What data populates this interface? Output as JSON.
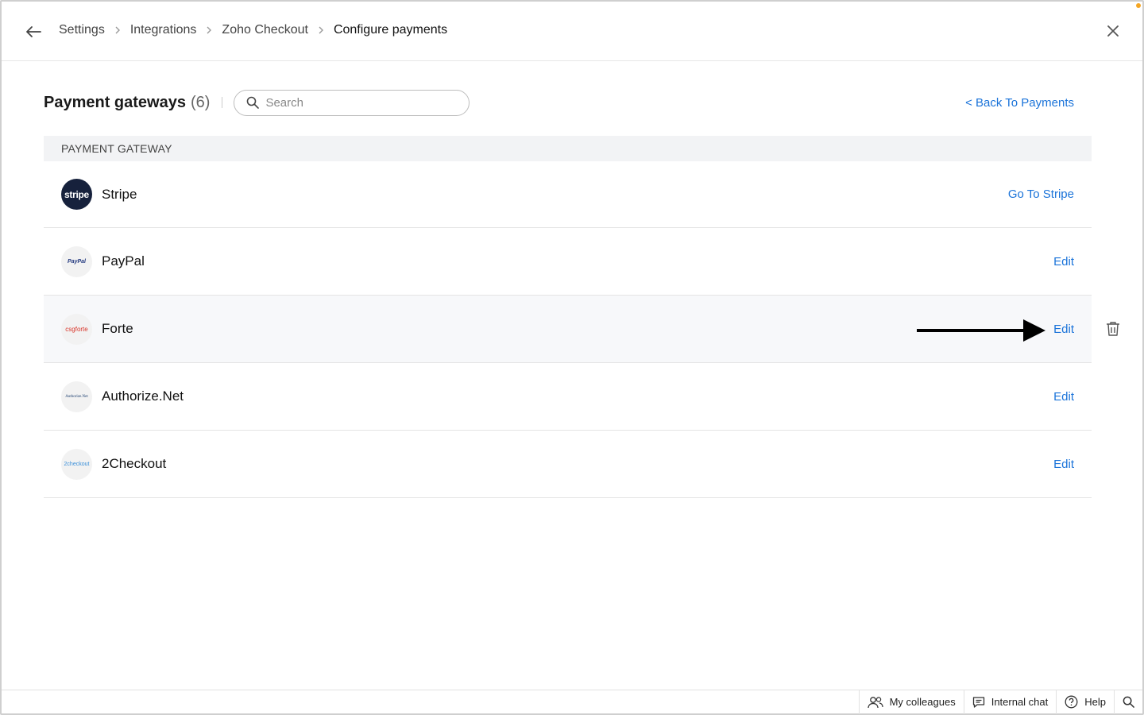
{
  "breadcrumb": {
    "items": [
      "Settings",
      "Integrations",
      "Zoho Checkout",
      "Configure payments"
    ]
  },
  "header": {
    "title": "Payment gateways",
    "count": "(6)",
    "search_placeholder": "Search",
    "back_link": "< Back To Payments"
  },
  "table": {
    "column_header": "PAYMENT GATEWAY",
    "rows": [
      {
        "name": "Stripe",
        "logo_text": "stripe",
        "action": "Go To Stripe"
      },
      {
        "name": "PayPal",
        "logo_text": "PayPal",
        "action": "Edit"
      },
      {
        "name": "Forte",
        "logo_text": "csgforte",
        "action": "Edit"
      },
      {
        "name": "Authorize.Net",
        "logo_text": "Authorize.Net",
        "action": "Edit"
      },
      {
        "name": "2Checkout",
        "logo_text": "2checkout",
        "action": "Edit"
      }
    ]
  },
  "footer": {
    "colleagues": "My colleagues",
    "chat": "Internal chat",
    "help": "Help"
  },
  "colors": {
    "link": "#1a73d9",
    "stripe_bg": "#16213c",
    "forte_red": "#d9362b",
    "paypal_blue": "#253b80",
    "twocheckout_blue": "#3a8fd9",
    "notification_dot": "#f5a623"
  }
}
